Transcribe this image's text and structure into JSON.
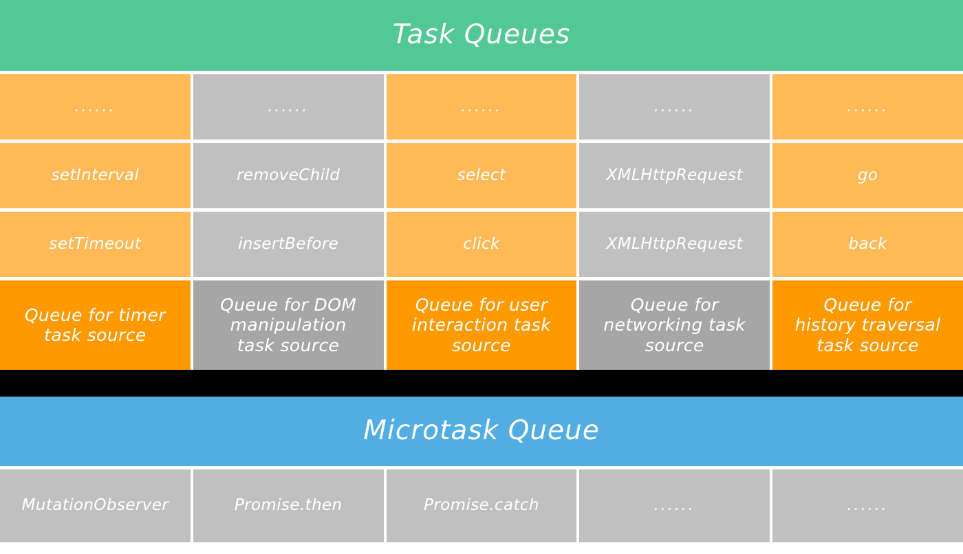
{
  "task_queues": {
    "banner_title": "Task Queues",
    "banner_color": "#52c894",
    "colors": {
      "orange_light": "#ffb957",
      "gray_light": "#c0c0c0",
      "orange_dark": "#ff9900",
      "gray_dark": "#a6a6a6"
    },
    "columns": [
      {
        "ellipsis": "......",
        "entries": [
          "setInterval",
          "setTimeout"
        ],
        "label": "Queue for timer\ntask source",
        "tone": "orange"
      },
      {
        "ellipsis": "......",
        "entries": [
          "removeChild",
          "insertBefore"
        ],
        "label": "Queue for DOM\nmanipulation\ntask source",
        "tone": "gray"
      },
      {
        "ellipsis": "......",
        "entries": [
          "select",
          "click"
        ],
        "label": "Queue for user\ninteraction task\nsource",
        "tone": "orange"
      },
      {
        "ellipsis": "......",
        "entries": [
          "XMLHttpRequest",
          "XMLHttpRequest"
        ],
        "label": "Queue for\nnetworking task\nsource",
        "tone": "gray"
      },
      {
        "ellipsis": "......",
        "entries": [
          "go",
          "back"
        ],
        "label": "Queue for\nhistory traversal\ntask source",
        "tone": "orange"
      }
    ]
  },
  "separator": {
    "color": "#000000"
  },
  "microtask_queue": {
    "banner_title": "Microtask Queue",
    "banner_color": "#52ade3",
    "cell_color": "#c0c0c0",
    "entries": [
      "MutationObserver",
      "Promise.then",
      "Promise.catch",
      "......",
      "......"
    ]
  }
}
